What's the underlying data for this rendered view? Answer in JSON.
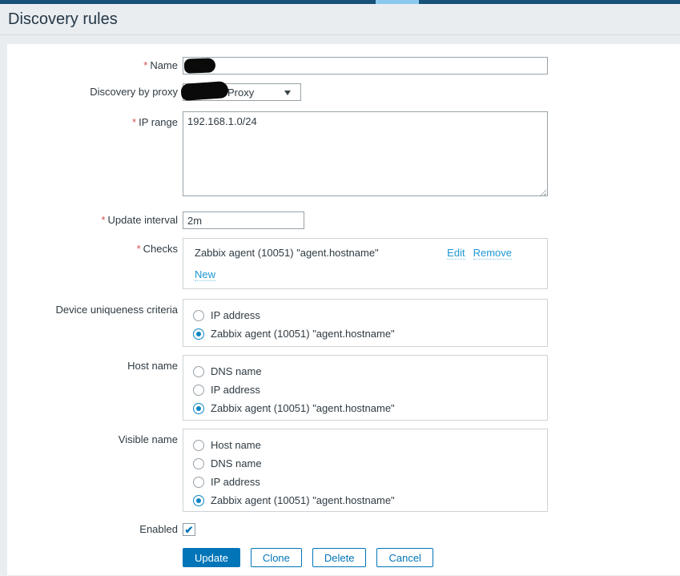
{
  "topbar": {
    "dark_color": "#175179",
    "accent_color": "#8bc8ee"
  },
  "header": {
    "title": "Discovery rules"
  },
  "required_marker": "*",
  "form": {
    "name": {
      "label": "Name",
      "value": "",
      "redacted": true
    },
    "proxy": {
      "label": "Discovery by proxy",
      "selected_value": "Proxy",
      "redacted_prefix": true
    },
    "ip_range": {
      "label": "IP range",
      "value": "192.168.1.0/24"
    },
    "update_interval": {
      "label": "Update interval",
      "value": "2m"
    },
    "checks": {
      "label": "Checks",
      "items": [
        {
          "name": "Zabbix agent (10051) \"agent.hostname\"",
          "edit_label": "Edit",
          "remove_label": "Remove"
        }
      ],
      "new_label": "New"
    },
    "uniqueness": {
      "label": "Device uniqueness criteria",
      "options": [
        "IP address",
        "Zabbix agent (10051) \"agent.hostname\""
      ],
      "selected_index": 1
    },
    "host_name": {
      "label": "Host name",
      "options": [
        "DNS name",
        "IP address",
        "Zabbix agent (10051) \"agent.hostname\""
      ],
      "selected_index": 2
    },
    "visible_name": {
      "label": "Visible name",
      "options": [
        "Host name",
        "DNS name",
        "IP address",
        "Zabbix agent (10051) \"agent.hostname\""
      ],
      "selected_index": 3
    },
    "enabled": {
      "label": "Enabled",
      "checked": true,
      "check_glyph": "✔"
    },
    "buttons": {
      "update": "Update",
      "clone": "Clone",
      "delete": "Delete",
      "cancel": "Cancel"
    }
  },
  "colors": {
    "accent_blue": "#0275b8",
    "link_blue": "#1e97d3",
    "radio_selected": "#0e84c4",
    "required_red": "#d64e4e",
    "page_background": "#e9edf0",
    "topbar_dark": "#175179",
    "topbar_accent": "#8bc8ee"
  }
}
